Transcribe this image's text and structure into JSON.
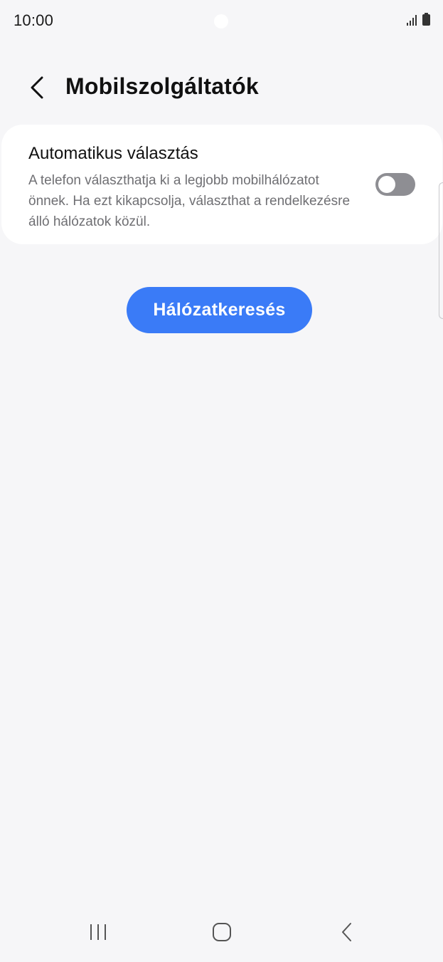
{
  "status_bar": {
    "time": "10:00"
  },
  "header": {
    "title": "Mobilszolgáltatók"
  },
  "automatic_selection": {
    "title": "Automatikus választás",
    "description": "A telefon választhatja ki a legjobb mobilhálózatot önnek. Ha ezt kikapcsolja, választhat a rendelkezésre álló hálózatok közül.",
    "toggle_on": false
  },
  "search_button": {
    "label": "Hálózatkeresés"
  },
  "colors": {
    "background": "#f6f6f8",
    "card": "#ffffff",
    "accent": "#3a7bf7",
    "toggle_off": "#8e8e93",
    "secondary_text": "#6f6f73"
  },
  "icons": {
    "back": "chevron-left-icon",
    "signal": "signal-icon",
    "battery": "battery-icon",
    "nav_recents": "recents-icon",
    "nav_home": "home-icon",
    "nav_back": "nav-back-icon"
  }
}
